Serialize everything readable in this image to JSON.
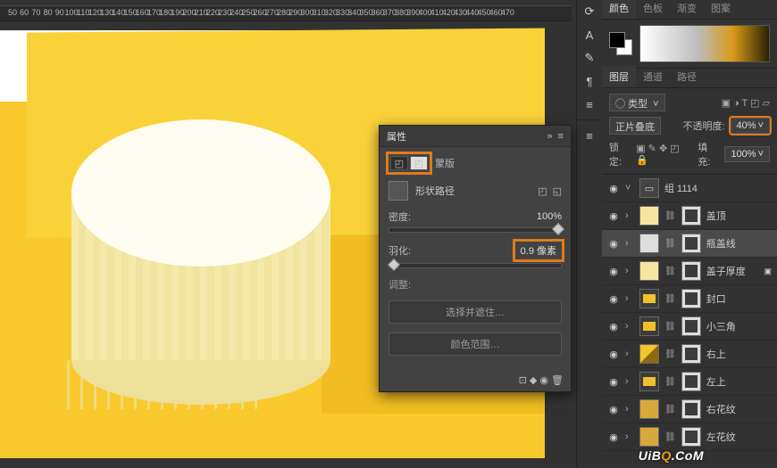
{
  "ruler_marks": [
    "50",
    "60",
    "70",
    "80",
    "90",
    "100",
    "110",
    "120",
    "130",
    "140",
    "150",
    "160",
    "170",
    "180",
    "190",
    "200",
    "210",
    "220",
    "230",
    "240",
    "250",
    "260",
    "270",
    "280",
    "290",
    "300",
    "310",
    "320",
    "330",
    "340",
    "350",
    "360",
    "370",
    "380",
    "390",
    "400",
    "410",
    "420",
    "430",
    "440",
    "450",
    "460",
    "470"
  ],
  "vtools": [
    "⟳",
    "A",
    "✎",
    "¶",
    "≡"
  ],
  "color_panel": {
    "tabs": [
      "颜色",
      "色板",
      "渐变",
      "图案"
    ],
    "active": 0
  },
  "layers": {
    "tabs": [
      "图层",
      "通道",
      "路径"
    ],
    "active": 0,
    "kind": "类型",
    "blend": "正片叠底",
    "opacity_label": "不透明度:",
    "opacity_value": "40%",
    "lock_label": "锁定:",
    "fill_label": "填充:",
    "fill_value": "100%",
    "items": [
      {
        "type": "group",
        "name": "组 1114",
        "open": true
      },
      {
        "type": "layer",
        "name": "盖顶",
        "mask": true,
        "color": "#f6e6a2"
      },
      {
        "type": "layer",
        "name": "瓶盖线",
        "mask": true,
        "active": true,
        "color": "#dddddd"
      },
      {
        "type": "layer",
        "name": "盖子厚度",
        "mask": true,
        "extra": true,
        "color": "#f6e6a2"
      },
      {
        "type": "layer",
        "name": "封口",
        "mask": true,
        "shape": true,
        "color": "#f0c22a"
      },
      {
        "type": "layer",
        "name": "小三角",
        "mask": true,
        "shape": true,
        "color": "#f0c22a"
      },
      {
        "type": "layer",
        "name": "右上",
        "mask": true,
        "grad": true
      },
      {
        "type": "layer",
        "name": "左上",
        "mask": true,
        "shape": true,
        "color": "#f0c22a"
      },
      {
        "type": "layer",
        "name": "右花纹",
        "mask": true,
        "color": "#d8a93a"
      },
      {
        "type": "layer",
        "name": "左花纹",
        "mask": true,
        "color": "#d8a93a"
      }
    ]
  },
  "props": {
    "title": "属性",
    "mask_label": "蒙版",
    "shape_label": "形状路径",
    "density_label": "密度:",
    "density_value": "100%",
    "feather_label": "羽化:",
    "feather_value": "0.9 像素",
    "adjust_label": "调整:",
    "btn1": "选择并遮住…",
    "btn2": "颜色范围…"
  },
  "watermark": {
    "a": "UiB",
    "b": "Q",
    "c": ".CoM"
  }
}
